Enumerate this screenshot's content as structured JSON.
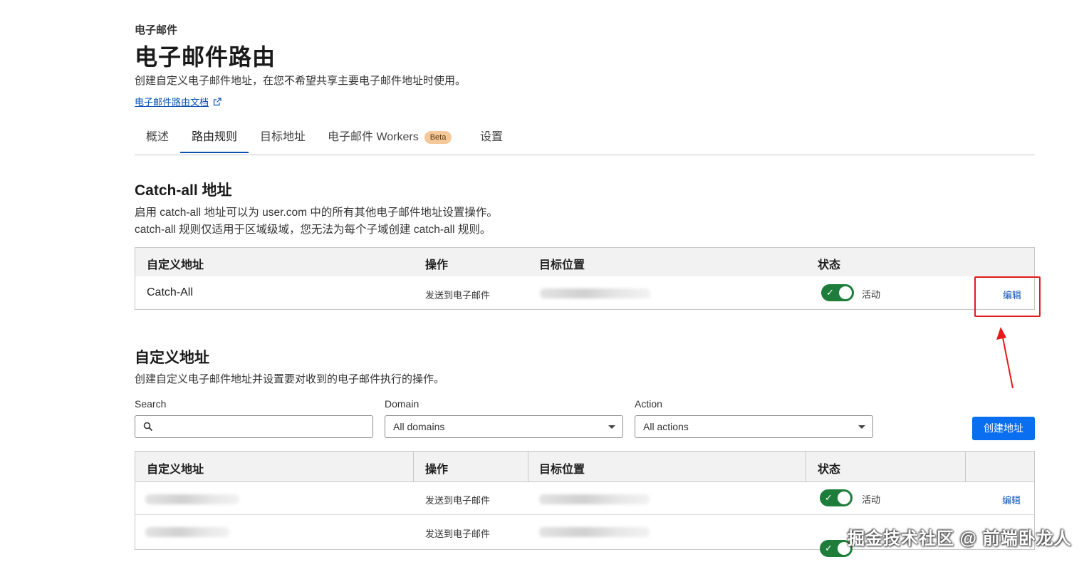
{
  "header": {
    "breadcrumb": "电子邮件",
    "title": "电子邮件路由",
    "description": "创建自定义电子邮件地址，在您不希望共享主要电子邮件地址时使用。",
    "docs_link": "电子邮件路由文档"
  },
  "tabs": [
    {
      "label": "概述"
    },
    {
      "label": "路由规则",
      "active": true
    },
    {
      "label": "目标地址"
    },
    {
      "label": "电子邮件 Workers",
      "badge": "Beta"
    },
    {
      "label": "设置"
    }
  ],
  "catch_all": {
    "heading": "Catch-all 地址",
    "desc_line1": "启用 catch-all 地址可以为 user.com 中的所有其他电子邮件地址设置操作。",
    "desc_line2": "catch-all 规则仅适用于区域级域，您无法为每个子域创建 catch-all 规则。",
    "columns": [
      "自定义地址",
      "操作",
      "目标位置",
      "状态"
    ],
    "row": {
      "address": "Catch-All",
      "action": "发送到电子邮件",
      "status": "活动",
      "edit": "编辑"
    }
  },
  "custom": {
    "heading": "自定义地址",
    "desc": "创建自定义电子邮件地址并设置要对收到的电子邮件执行的操作。",
    "search_label": "Search",
    "domain_label": "Domain",
    "domain_value": "All domains",
    "action_label": "Action",
    "action_value": "All actions",
    "create_button": "创建地址",
    "columns": [
      "自定义地址",
      "操作",
      "目标位置",
      "状态"
    ],
    "rows": [
      {
        "action": "发送到电子邮件",
        "status": "活动",
        "edit": "编辑"
      },
      {
        "action": "发送到电子邮件"
      }
    ]
  },
  "watermark": "掘金技术社区 @ 前端卧龙人",
  "colors": {
    "accent": "#0a52b5",
    "button": "#0a6ef0",
    "toggle_on": "#1e7d3a",
    "annotation": "#e21b1b",
    "badge": "#f5c89a"
  },
  "icons": [
    "external-link-icon",
    "search-icon",
    "chevron-down-icon",
    "check-icon"
  ]
}
